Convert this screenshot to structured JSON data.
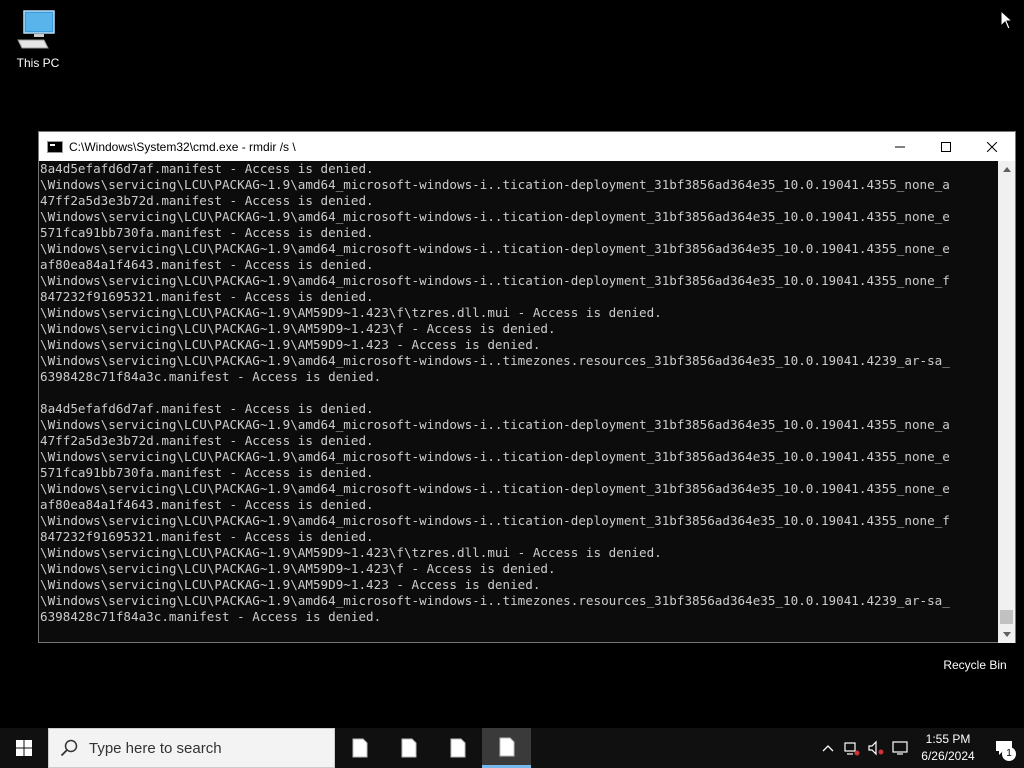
{
  "desktop": {
    "icons": [
      {
        "label": "This PC"
      },
      {
        "label": "Recycle Bin"
      }
    ]
  },
  "window": {
    "title": "C:\\Windows\\System32\\cmd.exe - rmdir  /s \\",
    "controls": {
      "minimize": "minimize",
      "maximize": "maximize",
      "close": "close"
    }
  },
  "console": {
    "lines": [
      "8a4d5efafd6d7af.manifest - Access is denied.",
      "\\Windows\\servicing\\LCU\\PACKAG~1.9\\amd64_microsoft-windows-i..tication-deployment_31bf3856ad364e35_10.0.19041.4355_none_a",
      "47ff2a5d3e3b72d.manifest - Access is denied.",
      "\\Windows\\servicing\\LCU\\PACKAG~1.9\\amd64_microsoft-windows-i..tication-deployment_31bf3856ad364e35_10.0.19041.4355_none_e",
      "571fca91bb730fa.manifest - Access is denied.",
      "\\Windows\\servicing\\LCU\\PACKAG~1.9\\amd64_microsoft-windows-i..tication-deployment_31bf3856ad364e35_10.0.19041.4355_none_e",
      "af80ea84a1f4643.manifest - Access is denied.",
      "\\Windows\\servicing\\LCU\\PACKAG~1.9\\amd64_microsoft-windows-i..tication-deployment_31bf3856ad364e35_10.0.19041.4355_none_f",
      "847232f91695321.manifest - Access is denied.",
      "\\Windows\\servicing\\LCU\\PACKAG~1.9\\AM59D9~1.423\\f\\tzres.dll.mui - Access is denied.",
      "\\Windows\\servicing\\LCU\\PACKAG~1.9\\AM59D9~1.423\\f - Access is denied.",
      "\\Windows\\servicing\\LCU\\PACKAG~1.9\\AM59D9~1.423 - Access is denied.",
      "\\Windows\\servicing\\LCU\\PACKAG~1.9\\amd64_microsoft-windows-i..timezones.resources_31bf3856ad364e35_10.0.19041.4239_ar-sa_",
      "6398428c71f84a3c.manifest - Access is denied.",
      "",
      "8a4d5efafd6d7af.manifest - Access is denied.",
      "\\Windows\\servicing\\LCU\\PACKAG~1.9\\amd64_microsoft-windows-i..tication-deployment_31bf3856ad364e35_10.0.19041.4355_none_a",
      "47ff2a5d3e3b72d.manifest - Access is denied.",
      "\\Windows\\servicing\\LCU\\PACKAG~1.9\\amd64_microsoft-windows-i..tication-deployment_31bf3856ad364e35_10.0.19041.4355_none_e",
      "571fca91bb730fa.manifest - Access is denied.",
      "\\Windows\\servicing\\LCU\\PACKAG~1.9\\amd64_microsoft-windows-i..tication-deployment_31bf3856ad364e35_10.0.19041.4355_none_e",
      "af80ea84a1f4643.manifest - Access is denied.",
      "\\Windows\\servicing\\LCU\\PACKAG~1.9\\amd64_microsoft-windows-i..tication-deployment_31bf3856ad364e35_10.0.19041.4355_none_f",
      "847232f91695321.manifest - Access is denied.",
      "\\Windows\\servicing\\LCU\\PACKAG~1.9\\AM59D9~1.423\\f\\tzres.dll.mui - Access is denied.",
      "\\Windows\\servicing\\LCU\\PACKAG~1.9\\AM59D9~1.423\\f - Access is denied.",
      "\\Windows\\servicing\\LCU\\PACKAG~1.9\\AM59D9~1.423 - Access is denied.",
      "\\Windows\\servicing\\LCU\\PACKAG~1.9\\amd64_microsoft-windows-i..timezones.resources_31bf3856ad364e35_10.0.19041.4239_ar-sa_",
      "6398428c71f84a3c.manifest - Access is denied."
    ]
  },
  "taskbar": {
    "search_placeholder": "Type here to search",
    "apps": [
      {
        "icon": "file-icon",
        "active": false
      },
      {
        "icon": "file-icon",
        "active": false
      },
      {
        "icon": "file-icon",
        "active": false
      },
      {
        "icon": "file-icon",
        "active": true
      }
    ],
    "tray": {
      "icons": [
        "chevron-up-icon",
        "network-icon",
        "volume-icon",
        "display-icon"
      ],
      "time": "1:55 PM",
      "date": "6/26/2024",
      "notification_count": "1"
    }
  },
  "colors": {
    "console_bg": "#0c0c0c",
    "console_text": "#cccccc",
    "taskbar_bg": "#101010",
    "active_accent": "#76b9ed"
  }
}
